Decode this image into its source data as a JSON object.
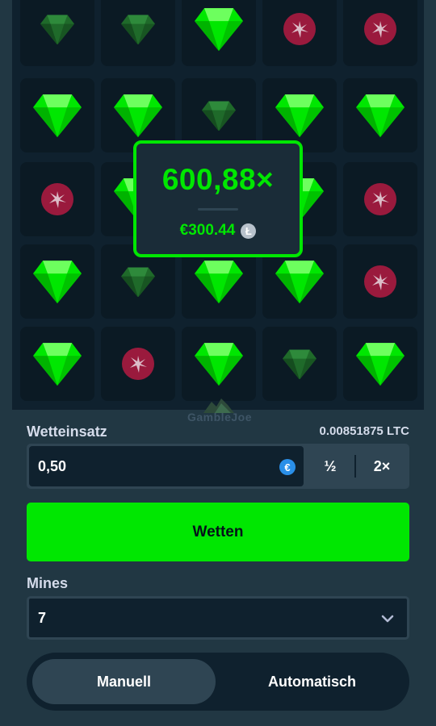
{
  "colors": {
    "accent": "#00e701",
    "background": "#213743",
    "board": "#0f212e",
    "tile": "#0b1a24",
    "gem_revealed": "#00e701",
    "gem_dim": "#1f6a2a",
    "mine": "#b01e46"
  },
  "grid": {
    "rows": [
      [
        "gem-dim",
        "gem-dim",
        "gem",
        "mine",
        "mine"
      ],
      [
        "gem",
        "gem",
        "gem-dim",
        "gem",
        "gem"
      ],
      [
        "mine",
        "gem",
        "gem",
        "gem",
        "mine"
      ],
      [
        "gem",
        "gem-dim",
        "gem",
        "gem",
        "mine"
      ],
      [
        "gem",
        "mine",
        "gem",
        "gem-dim",
        "gem"
      ]
    ]
  },
  "popup": {
    "multiplier": "600,88×",
    "payout": "€300.44",
    "currency_icon": "litecoin-icon"
  },
  "watermark": "GambleJoe",
  "bet": {
    "label": "Wetteinsatz",
    "crypto_amount": "0.00851875 LTC",
    "value": "0,50",
    "currency_icon": "euro-icon",
    "half_label": "½",
    "double_label": "2×"
  },
  "bet_button": "Wetten",
  "mines": {
    "label": "Mines",
    "value": "7"
  },
  "mode": {
    "manual": "Manuell",
    "auto": "Automatisch",
    "active": "manual"
  }
}
